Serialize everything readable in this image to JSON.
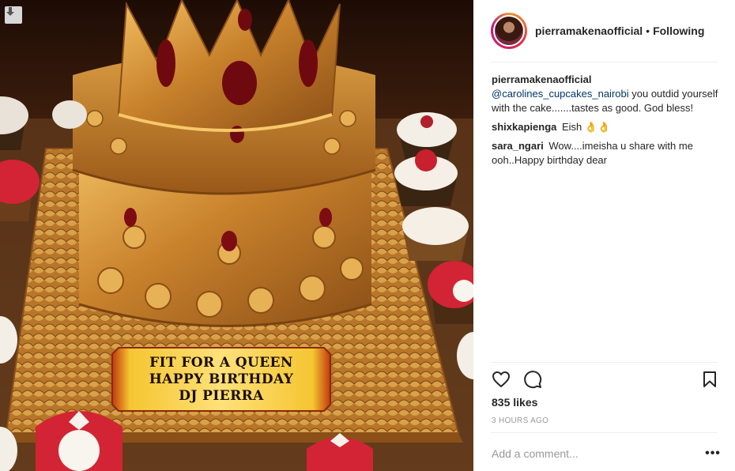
{
  "post": {
    "cake_plaque": {
      "line1": "FIT FOR A QUEEN",
      "line2": "HAPPY BIRTHDAY",
      "line3": "DJ PIERRA"
    }
  },
  "header": {
    "username": "pierramakenaofficial",
    "separator": "•",
    "follow_status": "Following"
  },
  "comments": [
    {
      "user": "pierramakenaofficial",
      "mention": "@carolines_cupcakes_nairobi",
      "text": " you outdid yourself with the cake.......tastes as good. God bless!"
    },
    {
      "user": "shixkapienga",
      "mention": "",
      "text": "Eish 👌👌"
    },
    {
      "user": "sara_ngari",
      "mention": "",
      "text": "Wow....imeisha u share with me ooh..Happy birthday dear"
    }
  ],
  "actions": {
    "icons": [
      "heart-icon",
      "comment-icon",
      "bookmark-icon"
    ]
  },
  "likes": "835 likes",
  "timestamp": "3 HOURS AGO",
  "add_comment": {
    "placeholder": "Add a comment...",
    "more_label": "•••"
  },
  "colors": {
    "mention": "#003569",
    "divider": "#efefef",
    "muted": "#999999",
    "gold": "#c98a2b"
  }
}
